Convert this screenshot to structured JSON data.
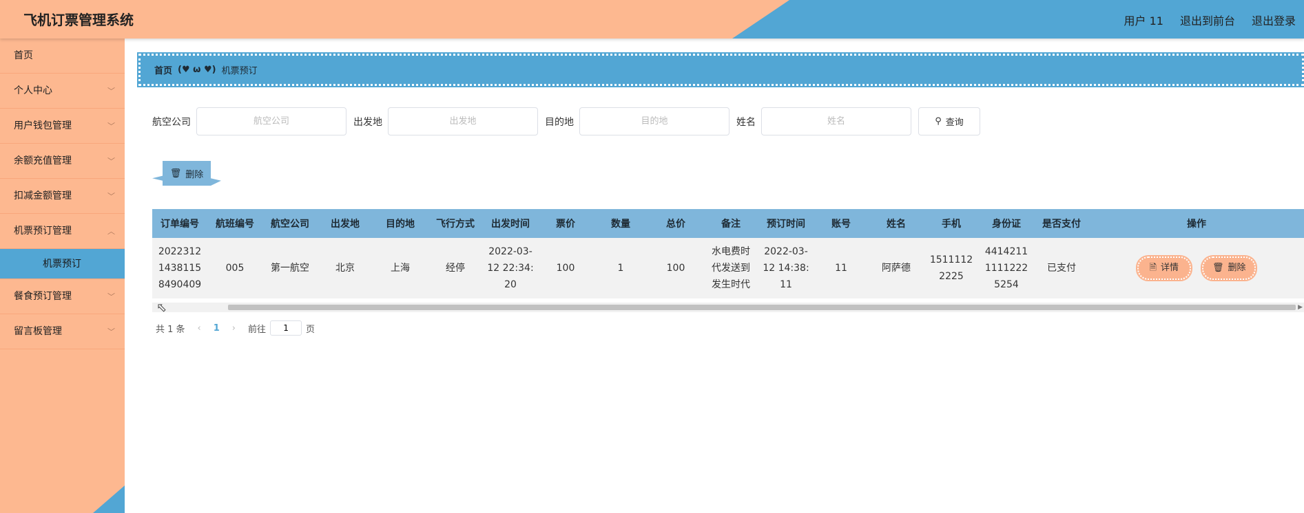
{
  "header": {
    "title": "飞机订票管理系统",
    "user": "用户 11",
    "back_to_front": "退出到前台",
    "logout": "退出登录"
  },
  "sidebar": {
    "items": [
      {
        "label": "首页"
      },
      {
        "label": "个人中心"
      },
      {
        "label": "用户钱包管理"
      },
      {
        "label": "余额充值管理"
      },
      {
        "label": "扣减金额管理"
      },
      {
        "label": "机票预订管理"
      },
      {
        "label": "机票预订"
      },
      {
        "label": "餐食预订管理"
      },
      {
        "label": "留言板管理"
      }
    ]
  },
  "breadcrumb": {
    "home": "首页",
    "separator": "(♥ ω ♥)",
    "current": "机票预订"
  },
  "search": {
    "airline_label": "航空公司",
    "airline_placeholder": "航空公司",
    "origin_label": "出发地",
    "origin_placeholder": "出发地",
    "dest_label": "目的地",
    "dest_placeholder": "目的地",
    "name_label": "姓名",
    "name_placeholder": "姓名",
    "query_label": "查询"
  },
  "toolbar": {
    "delete_label": "删除"
  },
  "table": {
    "headers": [
      "订单编号",
      "航班编号",
      "航空公司",
      "出发地",
      "目的地",
      "飞行方式",
      "出发时间",
      "票价",
      "数量",
      "总价",
      "备注",
      "预订时间",
      "账号",
      "姓名",
      "手机",
      "身份证",
      "是否支付",
      "操作"
    ],
    "rows": [
      {
        "order_no": "20223121438115 8490409",
        "flight_no": "005",
        "airline": "第一航空",
        "origin": "北京",
        "dest": "上海",
        "mode": "经停",
        "depart_time": "2022-03-12 22:34:20",
        "price": "100",
        "qty": "1",
        "total": "100",
        "remark": "水电费时代发送到发生时代",
        "book_time": "2022-03-12 14:38:11",
        "account": "11",
        "name": "阿萨德",
        "phone": "15111122225",
        "id_card": "441421111112225254",
        "paid": "已支付",
        "detail_label": "详情",
        "delete_label": "删除"
      }
    ]
  },
  "pager": {
    "total": "共 1 条",
    "current_page": "1",
    "goto_label": "前往",
    "goto_value": "1",
    "page_suffix": "页"
  }
}
